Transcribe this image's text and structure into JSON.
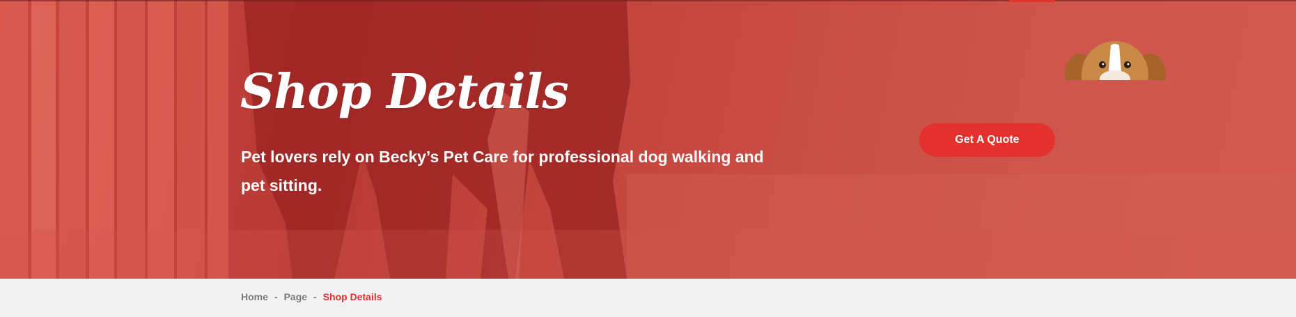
{
  "hero": {
    "title": "Shop Details",
    "subtitle": "Pet lovers rely on Becky’s Pet Care for professional dog walking and pet sitting.",
    "quote_button": "Get A Quote"
  },
  "breadcrumb": {
    "items": [
      "Home",
      "Page"
    ],
    "separator": "-",
    "current": "Shop Details"
  },
  "colors": {
    "hero_overlay": "#c9473f",
    "accent": "#e3322e",
    "breadcrumb_bg": "#f2f2f2",
    "breadcrumb_text": "#7b7b7b"
  },
  "icons": {
    "dog_peek": "beagle-dog-icon"
  }
}
